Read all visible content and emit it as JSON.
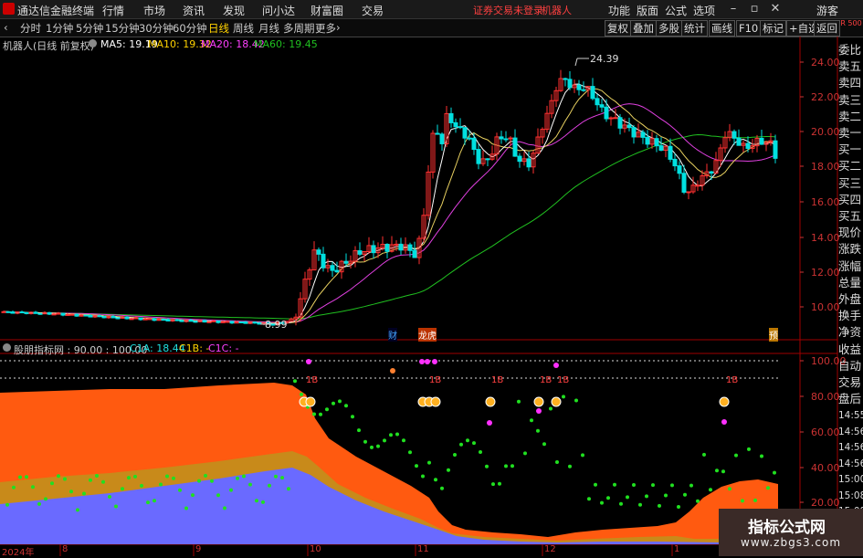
{
  "titlebar": {
    "app_name": "通达信金融终端",
    "menus": [
      "行情",
      "市场",
      "资讯",
      "发现",
      "问小达",
      "财富圈",
      "交易"
    ],
    "warning": "证券交易未登录",
    "stock_name": "机器人",
    "right_menus": [
      "功能",
      "版面",
      "公式",
      "选项"
    ],
    "user": "游客"
  },
  "toolbar": {
    "periods": [
      "分时",
      "1分钟",
      "5分钟",
      "15分钟",
      "30分钟",
      "60分钟",
      "日线",
      "周线",
      "月线",
      "多周期",
      "更多"
    ],
    "active_period": "日线",
    "right_buttons": [
      "复权",
      "叠加",
      "多股",
      "统计",
      "画线",
      "F10",
      "标记",
      "+自选",
      "返回"
    ]
  },
  "price_chart": {
    "title": "机器人(日线 前复权)",
    "ma_labels": [
      {
        "text": "MA5: 19.19",
        "color": "#ffffff"
      },
      {
        "text": "MA10: 19.32",
        "color": "#ffd200"
      },
      {
        "text": "MA20: 18.42",
        "color": "#ff40ff"
      },
      {
        "text": "MA60: 19.45",
        "color": "#20c020"
      }
    ],
    "y_ticks": [
      "24.00",
      "22.00",
      "20.00",
      "18.00",
      "16.00",
      "14.00",
      "12.00",
      "10.00"
    ],
    "high_label": "24.39",
    "low_label": "8.99",
    "markers": [
      "财",
      "龙虎",
      "预"
    ],
    "up_color": "#ff3030",
    "down_color": "#00e0e0"
  },
  "indicator": {
    "title": "股朋指标网 : 90.00 : 100.00",
    "c1a": "C1A: 18.44",
    "c1b": "C1B: -",
    "c1c": "C1C: -",
    "y_ticks": [
      "100.00",
      "80.00",
      "60.00",
      "40.00",
      "20.00"
    ],
    "signal_labels": [
      "1B",
      "1B",
      "1B",
      "1B",
      "1B",
      "1B"
    ]
  },
  "x_axis": {
    "labels": [
      "2024年",
      "8",
      "9",
      "10",
      "11",
      "12",
      "1"
    ]
  },
  "right_panel": {
    "top_badge": "R 500",
    "items": [
      "委比",
      "卖五",
      "卖四",
      "卖三",
      "卖二",
      "卖一",
      "买一",
      "买二",
      "买三",
      "买四",
      "买五",
      "现价",
      "涨跌",
      "涨幅",
      "总量",
      "外盘",
      "换手",
      "净资",
      "收益",
      "自动",
      "交易",
      "盘后",
      "14:55",
      "14:56",
      "14:56",
      "14:56",
      "15:00",
      "15:08",
      "15:08"
    ]
  },
  "watermark": {
    "title": "指标公式网",
    "url": "www.zbgs3.com"
  }
}
